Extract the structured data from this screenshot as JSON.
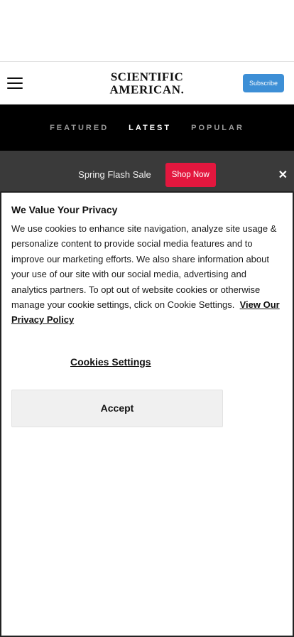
{
  "header": {
    "logo_line1": "SCIENTIFIC",
    "logo_line2": "AMERICAN.",
    "subscribe_label": "Subscribe"
  },
  "tabs": [
    {
      "label": "FEATURED",
      "active": false
    },
    {
      "label": "LATEST",
      "active": true
    },
    {
      "label": "POPULAR",
      "active": false
    }
  ],
  "promo": {
    "text": "Spring Flash Sale",
    "button_label": "Shop Now",
    "close_glyph": "✕"
  },
  "consent": {
    "title": "We Value Your Privacy",
    "body": "We use cookies to enhance site navigation, analyze site usage & personalize content to provide social media features and to improve our marketing efforts. We also share information about your use of our site with our social media, advertising and analytics partners. To opt out of website cookies or otherwise manage your cookie settings, click on Cookie Settings.",
    "privacy_link": "View Our Privacy Policy",
    "settings_label": "Cookies Settings",
    "accept_label": "Accept"
  },
  "colors": {
    "subscribe": "#3d8fd6",
    "shop_now": "#e3173e",
    "tabs_bg": "#000000",
    "promo_bg": "#3a3a3a"
  },
  "icons": {
    "menu": "hamburger-menu-icon",
    "close": "close-icon"
  }
}
